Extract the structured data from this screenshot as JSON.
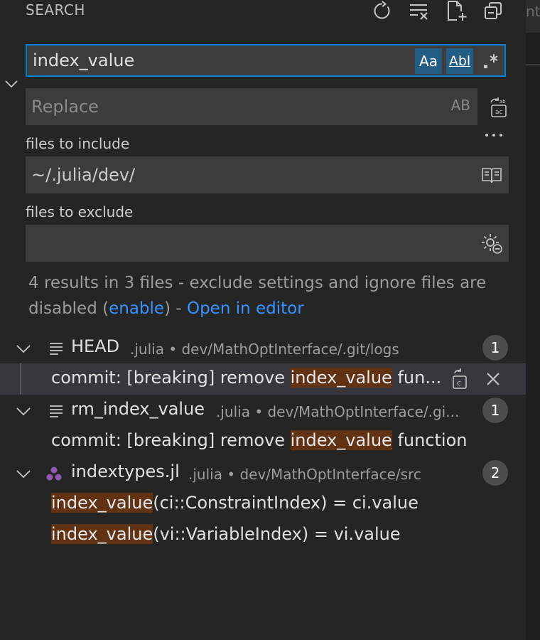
{
  "header": {
    "title": "SEARCH",
    "actions": [
      "refresh-icon",
      "clear-results-icon",
      "new-search-editor-icon",
      "collapse-all-icon"
    ]
  },
  "search": {
    "value": "index_value",
    "match_case_label": "Aa",
    "whole_word_label": "Abl",
    "regex_label": ".*",
    "match_case_on": true,
    "whole_word_on": true,
    "regex_on": false
  },
  "replace": {
    "placeholder": "Replace",
    "preserve_case_label": "AB"
  },
  "include": {
    "label": "files to include",
    "value": "~/.julia/dev/"
  },
  "exclude": {
    "label": "files to exclude",
    "value": ""
  },
  "summary": {
    "text": "4 results in 3 files - exclude settings and ignore files are disabled (",
    "enable_link": "enable",
    "text_after": ") - ",
    "open_link": "Open in editor"
  },
  "results": [
    {
      "name": "HEAD",
      "path": ".julia • dev/MathOptInterface/.git/logs",
      "count": "1",
      "matches": [
        {
          "before": "commit: [breaking] remove ",
          "match": "index_value",
          "after": " fun..."
        }
      ]
    },
    {
      "name": "rm_index_value",
      "path": ".julia • dev/MathOptInterface/.gi...",
      "count": "1",
      "matches": [
        {
          "before": "commit: [breaking] remove ",
          "match": "index_value",
          "after": " function"
        }
      ]
    },
    {
      "name": "indextypes.jl",
      "path": ".julia • dev/MathOptInterface/src",
      "count": "2",
      "matches": [
        {
          "before": "",
          "match": "index_value",
          "after": "(ci::ConstraintIndex) = ci.value"
        },
        {
          "before": "",
          "match": "index_value",
          "after": "(vi::VariableIndex) = vi.value"
        }
      ]
    }
  ],
  "colors": {
    "background": "#252526",
    "input": "#3c3c3c",
    "focus_border": "#007fd4",
    "toggle_on": "#235d86",
    "highlight": "#613214",
    "link": "#3794ff",
    "julia_icon": "#9558b2"
  },
  "editor_tab_fragment": "ntr"
}
